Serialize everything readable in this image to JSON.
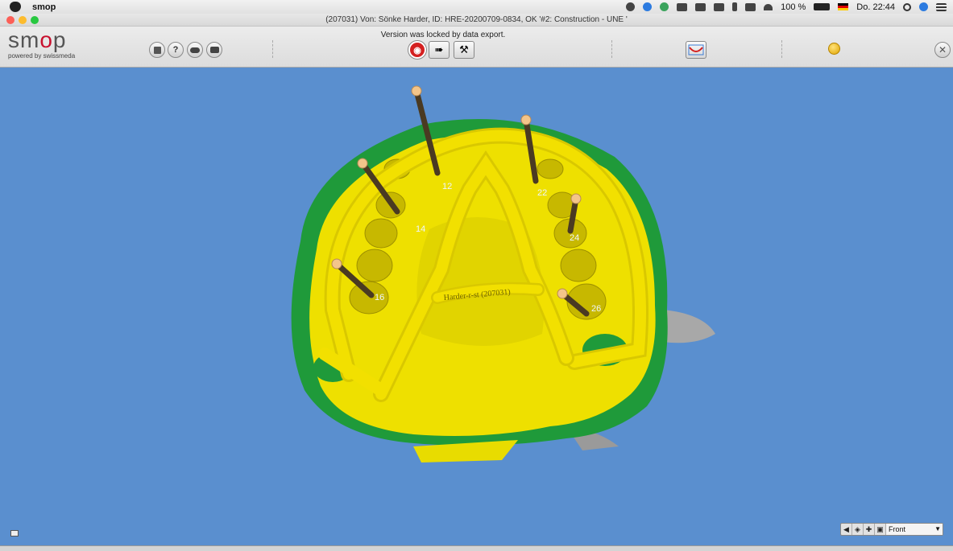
{
  "menubar": {
    "app_name": "smop",
    "battery": "100 %",
    "clock": "Do. 22:44"
  },
  "window": {
    "title": "(207031) Von: Sönke Harder, ID: HRE-20200709-0834, OK  '#2: Construction - UNE '"
  },
  "logo": {
    "word_part1": "sm",
    "word_o": "o",
    "word_part2": "p",
    "powered_by": "powered by swissmeda"
  },
  "toolbar": {
    "lock_message": "Version was locked by data export."
  },
  "model": {
    "tooth_labels": [
      "12",
      "14",
      "16",
      "22",
      "24",
      "26"
    ],
    "engraving": "Harder-r-st (207031)"
  },
  "view": {
    "selected": "Front"
  },
  "colors": {
    "background": "#5a8fcf",
    "framework": "#f2e000",
    "soft_tissue": "#1f9a3a",
    "status_dot": "#f0b400"
  }
}
